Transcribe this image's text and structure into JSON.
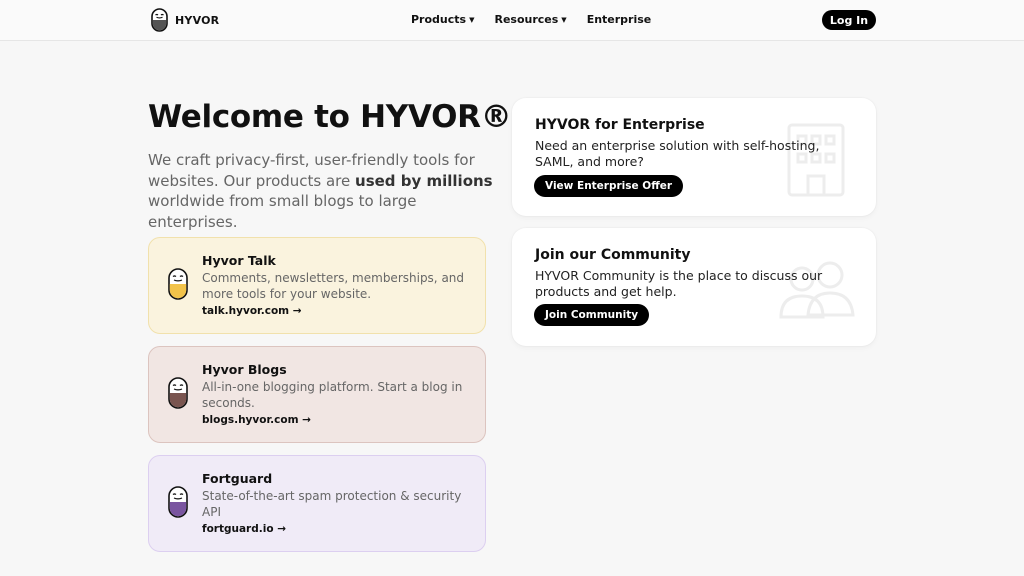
{
  "header": {
    "brand": "HYVOR",
    "nav": [
      {
        "label": "Products",
        "has_dropdown": true
      },
      {
        "label": "Resources",
        "has_dropdown": true
      },
      {
        "label": "Enterprise",
        "has_dropdown": false
      }
    ],
    "login_label": "Log In"
  },
  "hero": {
    "title": "Welcome to HYVOR®",
    "subtitle_pre": "We craft privacy-first, user-friendly tools for websites. Our products are ",
    "subtitle_bold": "used by millions",
    "subtitle_post": " worldwide from small blogs to large enterprises."
  },
  "products": [
    {
      "name": "Hyvor Talk",
      "description": "Comments, newsletters, memberships, and more tools for your website.",
      "link": "talk.hyvor.com",
      "arrow": "→",
      "color": "#f2c34a"
    },
    {
      "name": "Hyvor Blogs",
      "description": "All-in-one blogging platform. Start a blog in seconds.",
      "link": "blogs.hyvor.com",
      "arrow": "→",
      "color": "#7a5550"
    },
    {
      "name": "Fortguard",
      "description": "State-of-the-art spam protection & security API",
      "link": "fortguard.io",
      "arrow": "→",
      "color": "#7a55a0"
    }
  ],
  "cards": {
    "enterprise": {
      "title": "HYVOR for Enterprise",
      "description": "Need an enterprise solution with self-hosting, SAML, and more?",
      "button": "View Enterprise Offer",
      "icon": "building-icon"
    },
    "community": {
      "title": "Join our Community",
      "description": "HYVOR Community is the place to discuss our products and get help.",
      "button": "Join Community",
      "icon": "users-icon"
    }
  }
}
